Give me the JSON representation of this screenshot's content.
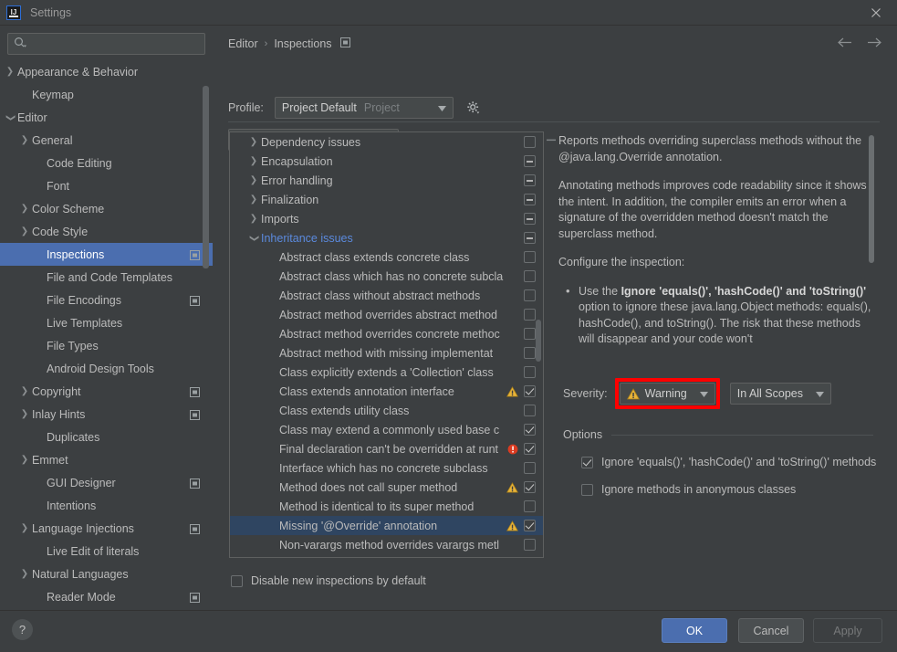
{
  "window": {
    "title": "Settings",
    "logo_text": "IJ",
    "close_icon": "close-icon"
  },
  "sidebar": {
    "search_placeholder": "",
    "search_value": "",
    "search_icon": "search-icon",
    "items": [
      {
        "label": "Appearance & Behavior",
        "indent": 0,
        "twisty": "collapsed",
        "badge": false,
        "selected": false
      },
      {
        "label": "Keymap",
        "indent": 1,
        "twisty": "none",
        "badge": false,
        "selected": false
      },
      {
        "label": "Editor",
        "indent": 0,
        "twisty": "expanded",
        "badge": false,
        "selected": false
      },
      {
        "label": "General",
        "indent": 1,
        "twisty": "collapsed",
        "badge": false,
        "selected": false
      },
      {
        "label": "Code Editing",
        "indent": 2,
        "twisty": "none",
        "badge": false,
        "selected": false
      },
      {
        "label": "Font",
        "indent": 2,
        "twisty": "none",
        "badge": false,
        "selected": false
      },
      {
        "label": "Color Scheme",
        "indent": 1,
        "twisty": "collapsed",
        "badge": false,
        "selected": false
      },
      {
        "label": "Code Style",
        "indent": 1,
        "twisty": "collapsed",
        "badge": false,
        "selected": false
      },
      {
        "label": "Inspections",
        "indent": 2,
        "twisty": "none",
        "badge": true,
        "selected": true
      },
      {
        "label": "File and Code Templates",
        "indent": 2,
        "twisty": "none",
        "badge": false,
        "selected": false
      },
      {
        "label": "File Encodings",
        "indent": 2,
        "twisty": "none",
        "badge": true,
        "selected": false
      },
      {
        "label": "Live Templates",
        "indent": 2,
        "twisty": "none",
        "badge": false,
        "selected": false
      },
      {
        "label": "File Types",
        "indent": 2,
        "twisty": "none",
        "badge": false,
        "selected": false
      },
      {
        "label": "Android Design Tools",
        "indent": 2,
        "twisty": "none",
        "badge": false,
        "selected": false
      },
      {
        "label": "Copyright",
        "indent": 1,
        "twisty": "collapsed",
        "badge": true,
        "selected": false
      },
      {
        "label": "Inlay Hints",
        "indent": 1,
        "twisty": "collapsed",
        "badge": true,
        "selected": false
      },
      {
        "label": "Duplicates",
        "indent": 2,
        "twisty": "none",
        "badge": false,
        "selected": false
      },
      {
        "label": "Emmet",
        "indent": 1,
        "twisty": "collapsed",
        "badge": false,
        "selected": false
      },
      {
        "label": "GUI Designer",
        "indent": 2,
        "twisty": "none",
        "badge": true,
        "selected": false
      },
      {
        "label": "Intentions",
        "indent": 2,
        "twisty": "none",
        "badge": false,
        "selected": false
      },
      {
        "label": "Language Injections",
        "indent": 1,
        "twisty": "collapsed",
        "badge": true,
        "selected": false
      },
      {
        "label": "Live Edit of literals",
        "indent": 2,
        "twisty": "none",
        "badge": false,
        "selected": false
      },
      {
        "label": "Natural Languages",
        "indent": 1,
        "twisty": "collapsed",
        "badge": false,
        "selected": false
      },
      {
        "label": "Reader Mode",
        "indent": 2,
        "twisty": "none",
        "badge": true,
        "selected": false
      }
    ]
  },
  "header": {
    "breadcrumb": [
      "Editor",
      "Inspections"
    ],
    "breadcrumb_separator": "›",
    "badge_icon": "project-scope-badge-icon",
    "back_icon": "arrow-left-icon",
    "forward_icon": "arrow-right-icon"
  },
  "profile": {
    "label": "Profile:",
    "value": "Project Default",
    "scope": "Project",
    "gear_icon": "gear-icon",
    "chevron_icon": "chevron-down-icon"
  },
  "toolbar": {
    "search_value": "",
    "search_placeholder": "",
    "search_icon": "search-icon",
    "buttons": [
      {
        "name": "filter-icon",
        "title": "Filter"
      },
      {
        "name": "expand-all-icon",
        "title": "Expand All"
      },
      {
        "name": "collapse-all-icon",
        "title": "Collapse All"
      },
      {
        "name": "reset-icon",
        "title": "Reset"
      },
      {
        "name": "add-icon",
        "title": "Add"
      },
      {
        "name": "remove-icon",
        "title": "Remove"
      }
    ]
  },
  "inspection_tree": {
    "rows": [
      {
        "label": "Dependency issues",
        "type": "group",
        "twisty": "collapsed",
        "state": "unchecked",
        "severity": null,
        "selected": false
      },
      {
        "label": "Encapsulation",
        "type": "group",
        "twisty": "collapsed",
        "state": "indeterminate",
        "severity": null,
        "selected": false
      },
      {
        "label": "Error handling",
        "type": "group",
        "twisty": "collapsed",
        "state": "indeterminate",
        "severity": null,
        "selected": false
      },
      {
        "label": "Finalization",
        "type": "group",
        "twisty": "collapsed",
        "state": "indeterminate",
        "severity": null,
        "selected": false
      },
      {
        "label": "Imports",
        "type": "group",
        "twisty": "collapsed",
        "state": "indeterminate",
        "severity": null,
        "selected": false
      },
      {
        "label": "Inheritance issues",
        "type": "group",
        "twisty": "expanded",
        "state": "indeterminate",
        "severity": null,
        "selected": false
      },
      {
        "label": "Abstract class extends concrete class",
        "type": "child",
        "twisty": "none",
        "state": "unchecked",
        "severity": null,
        "selected": false
      },
      {
        "label": "Abstract class which has no concrete subcla",
        "type": "child",
        "twisty": "none",
        "state": "unchecked",
        "severity": null,
        "selected": false
      },
      {
        "label": "Abstract class without abstract methods",
        "type": "child",
        "twisty": "none",
        "state": "unchecked",
        "severity": null,
        "selected": false
      },
      {
        "label": "Abstract method overrides abstract method",
        "type": "child",
        "twisty": "none",
        "state": "unchecked",
        "severity": null,
        "selected": false
      },
      {
        "label": "Abstract method overrides concrete methoc",
        "type": "child",
        "twisty": "none",
        "state": "unchecked",
        "severity": null,
        "selected": false
      },
      {
        "label": "Abstract method with missing implementat",
        "type": "child",
        "twisty": "none",
        "state": "unchecked",
        "severity": null,
        "selected": false
      },
      {
        "label": "Class explicitly extends a 'Collection' class",
        "type": "child",
        "twisty": "none",
        "state": "unchecked",
        "severity": null,
        "selected": false
      },
      {
        "label": "Class extends annotation interface",
        "type": "child",
        "twisty": "none",
        "state": "checked",
        "severity": "warning",
        "selected": false
      },
      {
        "label": "Class extends utility class",
        "type": "child",
        "twisty": "none",
        "state": "unchecked",
        "severity": null,
        "selected": false
      },
      {
        "label": "Class may extend a commonly used base c",
        "type": "child",
        "twisty": "none",
        "state": "checked",
        "severity": null,
        "selected": false
      },
      {
        "label": "Final declaration can't be overridden at runt",
        "type": "child",
        "twisty": "none",
        "state": "checked",
        "severity": "error",
        "selected": false
      },
      {
        "label": "Interface which has no concrete subclass",
        "type": "child",
        "twisty": "none",
        "state": "unchecked",
        "severity": null,
        "selected": false
      },
      {
        "label": "Method does not call super method",
        "type": "child",
        "twisty": "none",
        "state": "checked",
        "severity": "warning",
        "selected": false
      },
      {
        "label": "Method is identical to its super method",
        "type": "child",
        "twisty": "none",
        "state": "unchecked",
        "severity": null,
        "selected": false
      },
      {
        "label": "Missing '@Override' annotation",
        "type": "child",
        "twisty": "none",
        "state": "checked",
        "severity": "warning",
        "selected": true
      },
      {
        "label": "Non-varargs method overrides varargs metl",
        "type": "child",
        "twisty": "none",
        "state": "unchecked",
        "severity": null,
        "selected": false
      }
    ]
  },
  "description": {
    "paragraph_1": "Reports methods overriding superclass methods without the @java.lang.Override annotation.",
    "paragraph_2": "Annotating methods improves code readability since it shows the intent. In addition, the compiler emits an error when a signature of the overridden method doesn't match the superclass method.",
    "paragraph_3": "Configure the inspection:",
    "bullet_1_pre": "Use the ",
    "bullet_1_bold": "Ignore 'equals()', 'hashCode()' and 'toString()'",
    "bullet_1_post": " option to ignore these java.lang.Object methods: equals(), hashCode(), and toString(). The risk that these methods will disappear and your code won't"
  },
  "severity": {
    "label": "Severity:",
    "value": "Warning",
    "icon": "warning-triangle-icon",
    "chevron_icon": "chevron-down-icon",
    "scope_value": "In All Scopes",
    "highlight_color": "#ff0000"
  },
  "options": {
    "title": "Options",
    "items": [
      {
        "label": "Ignore 'equals()', 'hashCode()' and 'toString()' methods",
        "checked": true
      },
      {
        "label": "Ignore methods in anonymous classes",
        "checked": false
      }
    ]
  },
  "bottom": {
    "disable_new_label": "Disable new inspections by default",
    "disable_new_checked": false,
    "help_label": "?",
    "ok_label": "OK",
    "cancel_label": "Cancel",
    "apply_label": "Apply"
  }
}
